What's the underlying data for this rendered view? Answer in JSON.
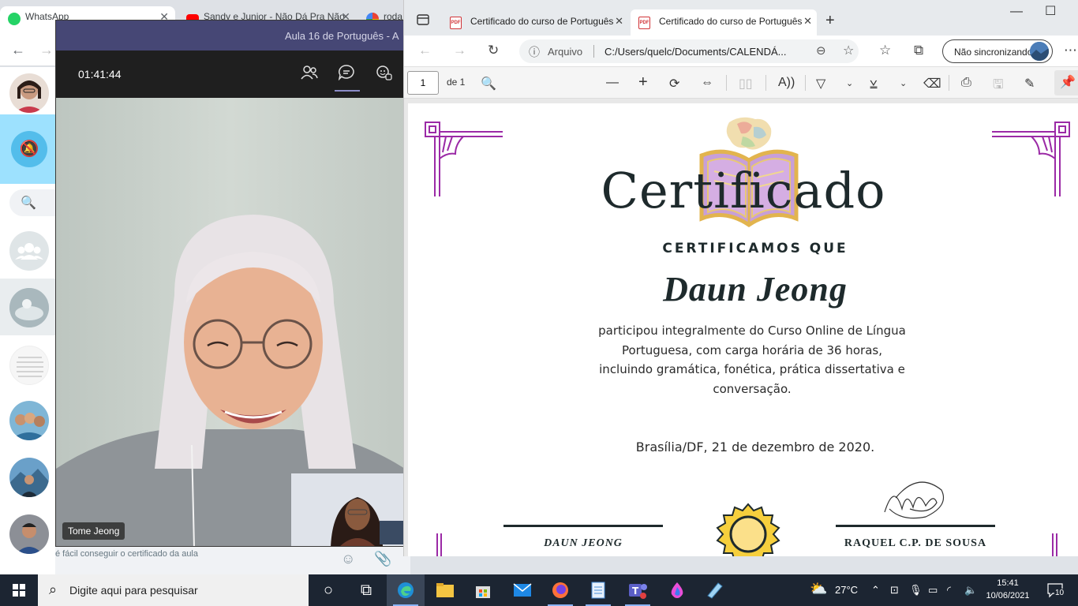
{
  "chrome": {
    "tabs": [
      {
        "title": "WhatsApp"
      },
      {
        "title": "Sandy e Junior - Não Dá Pra Não"
      },
      {
        "title": "roda"
      }
    ]
  },
  "whatsapp": {
    "preview_text": "é fácil conseguir o certificado da aula",
    "search_icon": "search-icon"
  },
  "teams": {
    "window_title": "Aula 16 de Português - A",
    "timer": "01:41:44",
    "participant_name": "Tome Jeong"
  },
  "edge": {
    "tabs": [
      {
        "title": "Certificado do curso de Português"
      },
      {
        "title": "Certificado do curso de Português"
      }
    ],
    "address_label": "Arquivo",
    "url": "C:/Users/quelc/Documents/CALENDÁ...",
    "sync_label": "Não sincronizando",
    "page_current": "1",
    "page_total": "de 1"
  },
  "certificate": {
    "title": "Certificado",
    "subtitle": "CERTIFICAMOS QUE",
    "recipient": "Daun Jeong",
    "body_lines": [
      "participou integralmente do Curso Online  de Língua",
      "Portuguesa, com carga horária de 36 horas,",
      "incluindo gramática, fonética, prática dissertativa e",
      "conversação."
    ],
    "place_date": "Brasília/DF, 21 de dezembro de 2020.",
    "signer_left": "DAUN JEONG",
    "signer_right": "RAQUEL C.P. DE SOUSA",
    "accent_color": "#9b2aa6"
  },
  "taskbar": {
    "search_placeholder": "Digite aqui para pesquisar",
    "temperature": "27°C",
    "time": "15:41",
    "date": "10/06/2021",
    "notification_count": "10"
  }
}
